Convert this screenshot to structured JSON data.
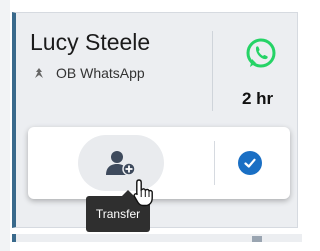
{
  "contact": {
    "name": "Lucy Steele",
    "channel_label": "OB WhatsApp",
    "channel_icon": "outbound-arrow-icon",
    "platform_icon": "whatsapp-icon",
    "duration": "2 hr"
  },
  "actions": {
    "transfer_icon": "add-user-icon",
    "confirm_icon": "check-circle-icon",
    "tooltip": "Transfer"
  },
  "colors": {
    "accent_bar": "#3a6a8c",
    "whatsapp": "#25d366",
    "confirm": "#1a6fc4"
  }
}
